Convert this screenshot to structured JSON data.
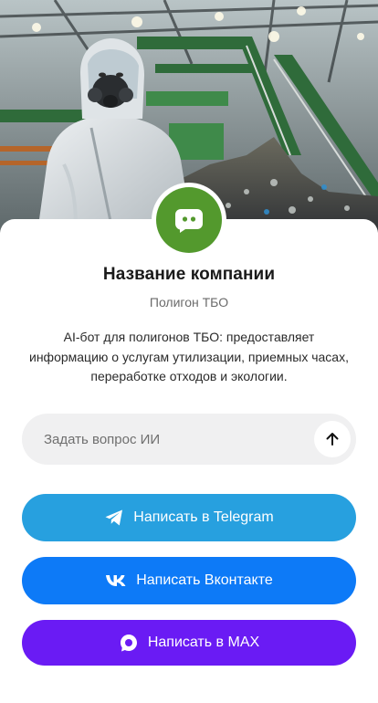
{
  "hero": {
    "image_alt": "Worker in protective suit at waste sorting facility"
  },
  "company": {
    "name": "Название компании",
    "subtitle": "Полигон ТБО",
    "description": "AI-бот для полигонов ТБО: предоставляет информацию о услугам утилизации, приемных часах, переработке отходов и экологии.",
    "avatar_icon": "chat-bot-icon",
    "avatar_color": "#53992d"
  },
  "ask": {
    "placeholder": "Задать вопрос ИИ",
    "send_icon": "arrow-up-icon"
  },
  "buttons": {
    "telegram": {
      "label": "Написать в Telegram",
      "icon": "telegram-icon",
      "color": "#27a0df"
    },
    "vk": {
      "label": "Написать Вконтакте",
      "icon": "vk-icon",
      "color": "#0d7af7"
    },
    "max": {
      "label": "Написать в MAX",
      "icon": "max-icon",
      "color": "#6a1bf4"
    }
  }
}
